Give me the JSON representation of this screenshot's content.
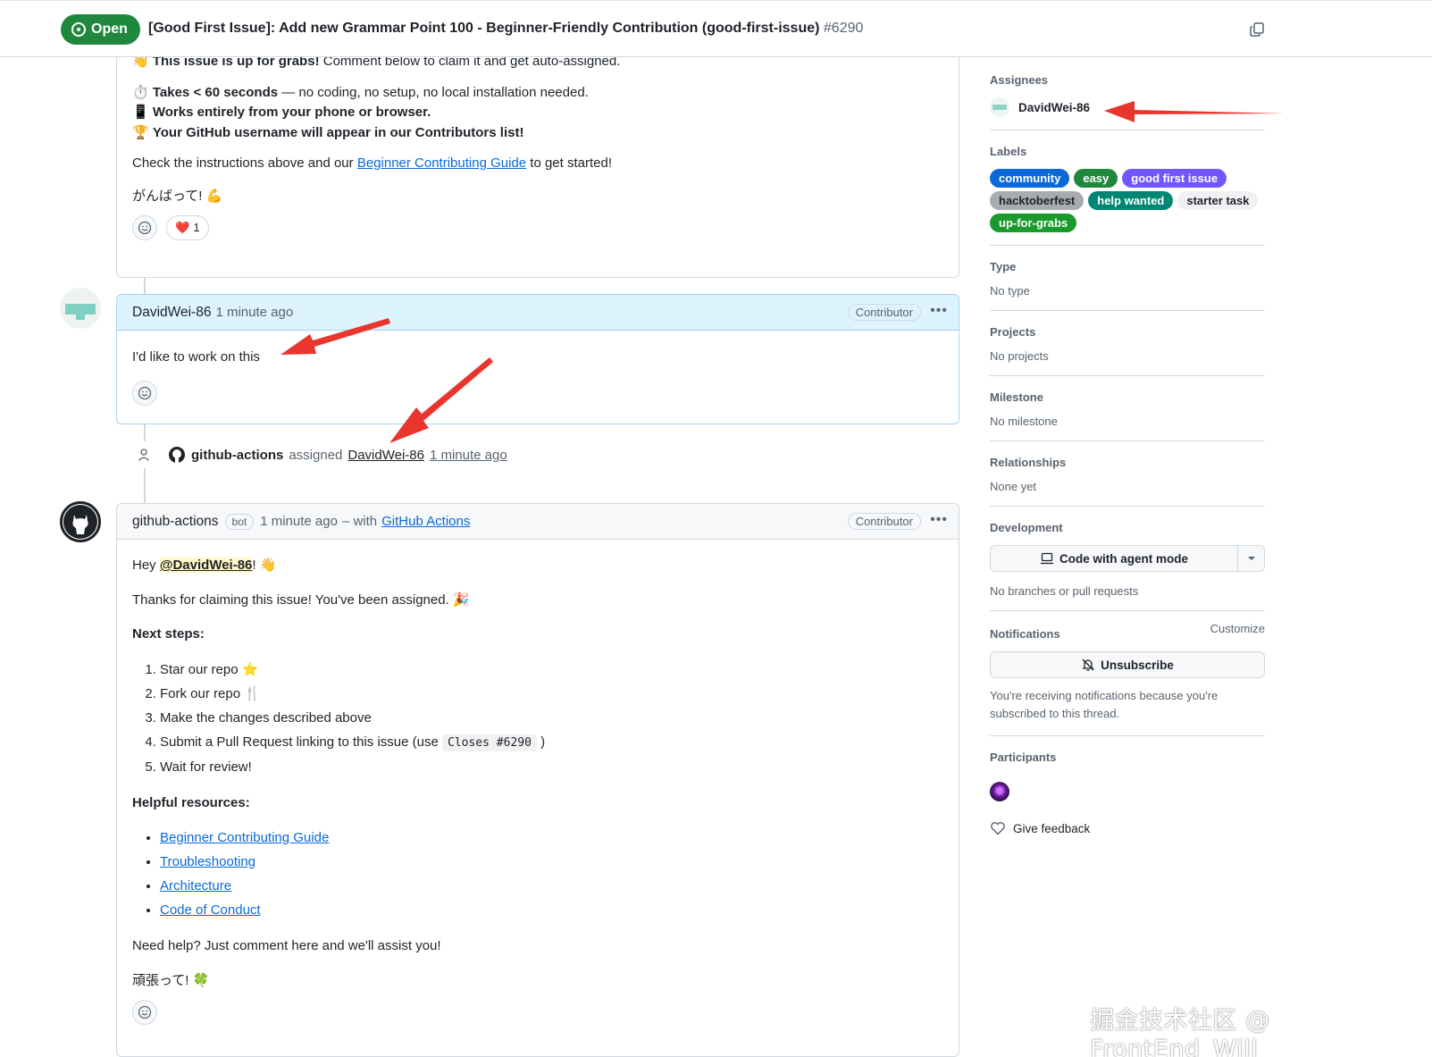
{
  "header": {
    "state": "Open",
    "title": "[Good First Issue]: Add new Grammar Point 100 - Beginner-Friendly Contribution (good-first-issue)",
    "number": "#6290"
  },
  "first_comment": {
    "line1_emoji": "👋",
    "line1_bold": "This issue is up for grabs!",
    "line1_rest": " Comment below to claim it and get auto-assigned.",
    "bullet1_emoji": "⏱️",
    "bullet1_bold": "Takes < 60 seconds",
    "bullet1_rest": " — no coding, no setup, no local installation needed.",
    "bullet2_emoji": "📱",
    "bullet2_bold": "Works entirely from your phone or browser.",
    "bullet3_emoji": "🏆",
    "bullet3_bold": "Your GitHub username will appear in our Contributors list!",
    "instructions_pre": "Check the instructions above and our ",
    "instructions_link": "Beginner Contributing Guide",
    "instructions_post": " to get started!",
    "cheer": "がんばって! 💪",
    "reaction_emoji": "❤️",
    "reaction_count": "1"
  },
  "comment_david": {
    "author": "DavidWei-86",
    "time": "1 minute ago",
    "role": "Contributor",
    "body": "I'd like to work on this"
  },
  "event": {
    "actor": "github-actions",
    "action": "assigned",
    "target": "DavidWei-86",
    "time": "1 minute ago"
  },
  "comment_bot": {
    "author": "github-actions",
    "bot_tag": "bot",
    "time": "1 minute ago",
    "with_text": "– with",
    "with_link": "GitHub Actions",
    "role": "Contributor",
    "greeting_pre": "Hey ",
    "greeting_mention": "@DavidWei-86",
    "greeting_post": "! 👋",
    "thanks": "Thanks for claiming this issue! You've been assigned. 🎉",
    "next_steps_heading": "Next steps:",
    "steps": [
      "Star our repo ⭐",
      "Fork our repo 🍴",
      "Make the changes described above",
      "Submit a Pull Request linking to this issue (use ",
      "Wait for review!"
    ],
    "step4_code": "Closes #6290",
    "step4_post": " )",
    "resources_heading": "Helpful resources:",
    "resources": [
      "Beginner Contributing Guide",
      "Troubleshooting",
      "Architecture",
      "Code of Conduct"
    ],
    "need_help": "Need help? Just comment here and we'll assist you!",
    "cheer": "頑張って! 🍀"
  },
  "sidebar": {
    "assignees_heading": "Assignees",
    "assignee": "DavidWei-86",
    "labels_heading": "Labels",
    "labels": [
      {
        "name": "community",
        "bg": "#0969da",
        "fg": "#ffffff"
      },
      {
        "name": "easy",
        "bg": "#1f883d",
        "fg": "#ffffff"
      },
      {
        "name": "good first issue",
        "bg": "#7057ff",
        "fg": "#ffffff"
      },
      {
        "name": "hacktoberfest",
        "bg": "#a8acb0",
        "fg": "#1f2328"
      },
      {
        "name": "help wanted",
        "bg": "#008672",
        "fg": "#ffffff"
      },
      {
        "name": "starter task",
        "bg": "#f0f1f3",
        "fg": "#1f2328"
      },
      {
        "name": "up-for-grabs",
        "bg": "#1a9a2c",
        "fg": "#ffffff"
      }
    ],
    "type_heading": "Type",
    "type_value": "No type",
    "projects_heading": "Projects",
    "projects_value": "No projects",
    "milestone_heading": "Milestone",
    "milestone_value": "No milestone",
    "relationships_heading": "Relationships",
    "relationships_value": "None yet",
    "development_heading": "Development",
    "dev_button": "Code with agent mode",
    "dev_value": "No branches or pull requests",
    "notifications_heading": "Notifications",
    "customize": "Customize",
    "unsubscribe": "Unsubscribe",
    "notif_reason": "You're receiving notifications because you're subscribed to this thread.",
    "participants_heading": "Participants",
    "feedback": "Give feedback"
  },
  "watermark": "掘金技术社区 @ FrontEnd_Will",
  "colors": {
    "open_green": "#1f883d",
    "link_blue": "#0969da",
    "highlight_bg": "#ddf4ff",
    "annotation_red": "#e8352e"
  }
}
